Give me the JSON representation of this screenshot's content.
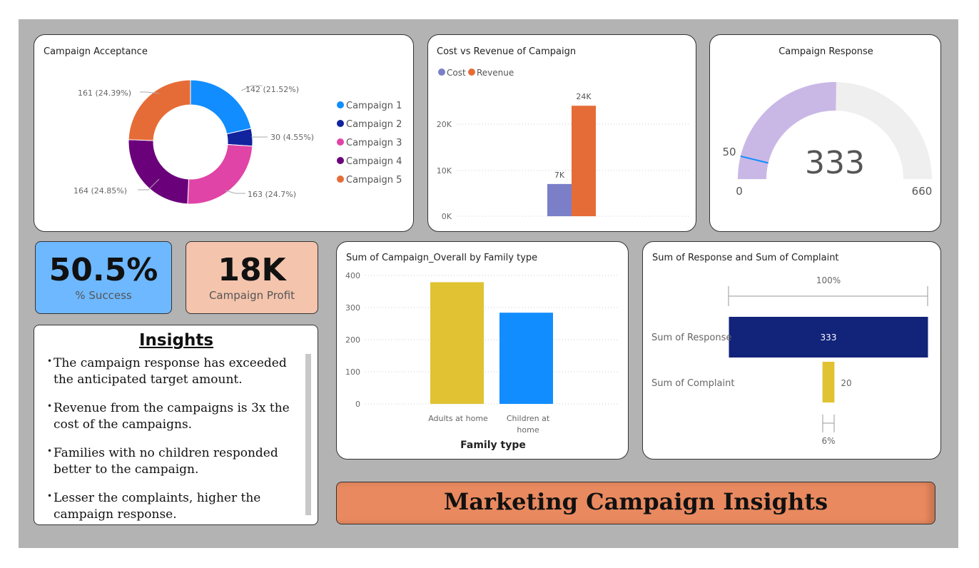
{
  "acceptance": {
    "title": "Campaign Acceptance",
    "legend": [
      "Campaign 1",
      "Campaign 2",
      "Campaign 3",
      "Campaign 4",
      "Campaign 5"
    ],
    "slice_labels": [
      "142 (21.52%)",
      "30 (4.55%)",
      "163 (24.7%)",
      "164 (24.85%)",
      "161 (24.39%)"
    ]
  },
  "cost_revenue": {
    "title": "Cost vs Revenue of Campaign",
    "legend": [
      "Cost",
      "Revenue"
    ],
    "ticks": [
      "20K",
      "10K",
      "0K"
    ],
    "labels": [
      "7K",
      "24K"
    ]
  },
  "response_gauge": {
    "title": "Campaign Response",
    "value_label": "333",
    "min_label": "0",
    "max_label": "660",
    "target_label": "50"
  },
  "kpis": {
    "success_value": "50.5%",
    "success_label": "% Success",
    "profit_value": "18K",
    "profit_label": "Campaign Profit"
  },
  "insights": {
    "title": "Insights",
    "items": [
      "The campaign response has exceeded the anticipated target amount.",
      "Revenue from the campaigns is 3x the cost of the campaigns.",
      "Families with no children responded better to the campaign.",
      "Lesser the complaints, higher the campaign response."
    ]
  },
  "family": {
    "title": "Sum of Campaign_Overall by Family type",
    "ticks": [
      "400",
      "300",
      "200",
      "100",
      "0"
    ],
    "cat1_line1": "Adults at home",
    "cat2_line1": "Children at",
    "cat2_line2": "home",
    "xlabel": "Family type"
  },
  "funnel": {
    "title": "Sum of Response and Sum of Complaint",
    "top_pct": "100%",
    "bottom_pct": "6%",
    "row1_label": "Sum of Response",
    "row1_value": "333",
    "row2_label": "Sum of Complaint",
    "row2_value": "20"
  },
  "banner": {
    "title": "Marketing Campaign Insights"
  },
  "colors": {
    "campaign1": "#118dff",
    "campaign2": "#12239e",
    "campaign3": "#e044a7",
    "campaign4": "#6b007b",
    "campaign5": "#e66c37",
    "cost": "#7a7fc8",
    "revenue": "#e66c37",
    "gauge_fill": "#c9b8e6",
    "gauge_bg": "#efefef",
    "adults": "#e0c233",
    "children": "#118dff",
    "response": "#12237a",
    "complaint": "#e0c233",
    "success_bg": "#6eb8ff",
    "profit_bg": "#f4c4ad"
  },
  "chart_data": [
    {
      "type": "pie",
      "title": "Campaign Acceptance",
      "categories": [
        "Campaign 1",
        "Campaign 2",
        "Campaign 3",
        "Campaign 4",
        "Campaign 5"
      ],
      "values": [
        142,
        30,
        163,
        164,
        161
      ],
      "percents": [
        21.52,
        4.55,
        24.7,
        24.85,
        24.39
      ],
      "legend": "right"
    },
    {
      "type": "bar",
      "title": "Cost vs Revenue of Campaign",
      "series": [
        {
          "name": "Cost",
          "values": [
            7000
          ]
        },
        {
          "name": "Revenue",
          "values": [
            24000
          ]
        }
      ],
      "ylim": [
        0,
        24000
      ],
      "legend": "top-left"
    },
    {
      "type": "gauge",
      "title": "Campaign Response",
      "value": 333,
      "min": 0,
      "max": 660,
      "target": 50
    },
    {
      "type": "bar",
      "title": "Sum of Campaign_Overall by Family type",
      "categories": [
        "Adults at home",
        "Children at home"
      ],
      "values": [
        379,
        284
      ],
      "xlabel": "Family type",
      "ylim": [
        0,
        400
      ]
    },
    {
      "type": "bar",
      "title": "Sum of Response and Sum of Complaint",
      "categories": [
        "Sum of Response",
        "Sum of Complaint"
      ],
      "values": [
        333,
        20
      ],
      "percent_of_first": [
        100,
        6
      ]
    }
  ]
}
